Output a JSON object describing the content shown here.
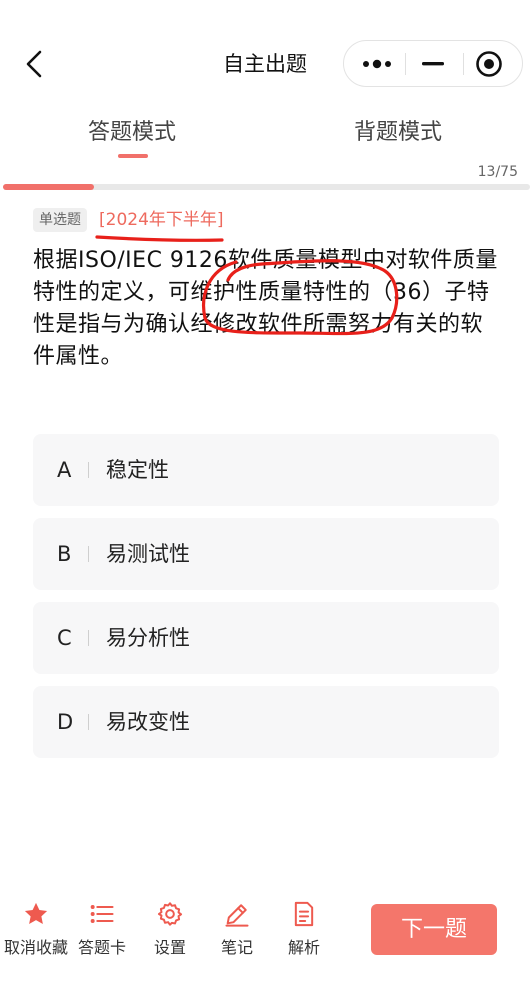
{
  "nav": {
    "title": "自主出题"
  },
  "tabs": [
    {
      "label": "答题模式"
    },
    {
      "label": "背题模式"
    }
  ],
  "progress": {
    "counter": "13/75",
    "current": 13,
    "total": 75
  },
  "question": {
    "type": "单选题",
    "source": "[2024年下半年]",
    "text": "根据ISO/IEC 9126软件质量模型中对软件质量特性的定义，可维护性质量特性的（36）子特性是指与为确认经修改软件所需努力有关的软件属性。"
  },
  "options": [
    {
      "letter": "A",
      "text": "稳定性"
    },
    {
      "letter": "B",
      "text": "易测试性"
    },
    {
      "letter": "C",
      "text": "易分析性"
    },
    {
      "letter": "D",
      "text": "易改变性"
    }
  ],
  "toolbar": {
    "favorite": "取消收藏",
    "answer_card": "答题卡",
    "settings": "设置",
    "notes": "笔记",
    "analysis": "解析",
    "next": "下一题"
  },
  "colors": {
    "accent": "#f1706a",
    "ink": "#e8201a"
  }
}
